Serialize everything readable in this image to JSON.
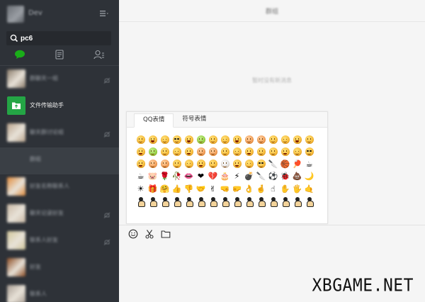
{
  "sidebar": {
    "user_name": "Dev",
    "search": {
      "value": "pc6"
    },
    "tabs": [
      {
        "name": "chat",
        "icon": "chat-icon",
        "color": "#1aad19"
      },
      {
        "name": "contacts",
        "icon": "contacts-card-icon"
      },
      {
        "name": "people",
        "icon": "people-icon"
      }
    ],
    "chats": [
      {
        "name": "群聊天一组",
        "blurred": true,
        "avatar_color": "#8a7b6a",
        "muted": true
      },
      {
        "name": "文件传输助手",
        "blurred": false,
        "avatar_color": "#24a545",
        "muted": false
      },
      {
        "name": "聊天群讨论组",
        "blurred": true,
        "avatar_color": "#b9a38c",
        "muted": true
      },
      {
        "name": "群组",
        "blurred": true,
        "avatar_color": "#3a3f45",
        "muted": false,
        "selected": true
      },
      {
        "name": "好友名称联系人",
        "blurred": true,
        "avatar_color": "#e08a3a",
        "muted": false
      },
      {
        "name": "聊天记录好友",
        "blurred": true,
        "avatar_color": "#c9b8a4",
        "muted": true
      },
      {
        "name": "联系人好友",
        "blurred": true,
        "avatar_color": "#d1c69b",
        "muted": true
      },
      {
        "name": "好友",
        "blurred": true,
        "avatar_color": "#8b4b22",
        "muted": false
      },
      {
        "name": "联系人",
        "blurred": true,
        "avatar_color": "#a89d93",
        "muted": false
      }
    ]
  },
  "main": {
    "title": "群组",
    "empty_message": "暂时没有新消息"
  },
  "emoji_panel": {
    "tabs": [
      "QQ表情",
      "符号表情"
    ],
    "active_tab": 0,
    "rows": 6,
    "cols": 15
  },
  "toolbar": {
    "buttons": [
      "emoji-icon",
      "scissors-icon",
      "folder-icon"
    ]
  },
  "watermark": "XBGAME.NET"
}
